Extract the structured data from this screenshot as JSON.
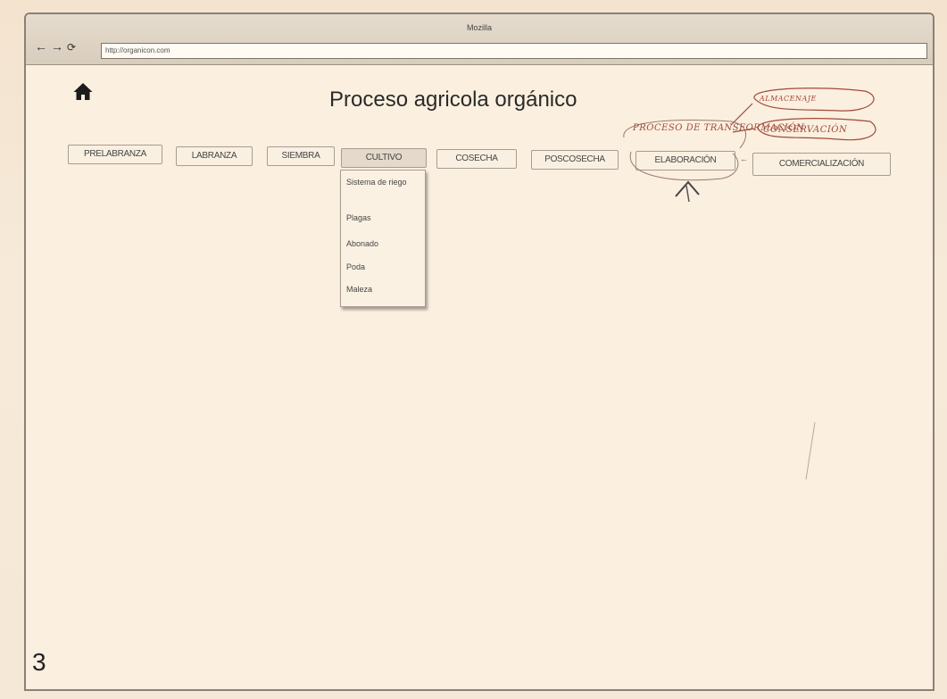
{
  "window": {
    "title": "Mozilla"
  },
  "browser": {
    "back_icon": "back-arrow-icon",
    "forward_icon": "forward-arrow-icon",
    "reload_icon": "reload-icon",
    "url": "http://organicon.com"
  },
  "page": {
    "home_icon": "home-icon",
    "title": "Proceso agricola orgánico",
    "nav": [
      {
        "label": "PRELABRANZA"
      },
      {
        "label": "LABRANZA"
      },
      {
        "label": "SIEMBRA"
      },
      {
        "label": "CULTIVO"
      },
      {
        "label": "COSECHA"
      },
      {
        "label": "POSCOSECHA"
      },
      {
        "label": "ELABORACIÓN"
      },
      {
        "label": "COMERCIALIZACIÓN"
      }
    ],
    "active_nav": "CULTIVO",
    "dropdown": {
      "items": [
        "Sistema de riego",
        "Plagas",
        "Abonado",
        "Poda",
        "Maleza"
      ]
    },
    "arrow_between": "←"
  },
  "annotations": {
    "proceso_de_transformacion": "PROCESO DE TRANSFORMACIÓN",
    "almacenaje": "ALMACENAJE",
    "conservacion": "CONSERVACIÓN"
  },
  "sheet_number": "3",
  "colors": {
    "paper": "#f5e7d5",
    "ink_annotation": "#a04a3a"
  }
}
